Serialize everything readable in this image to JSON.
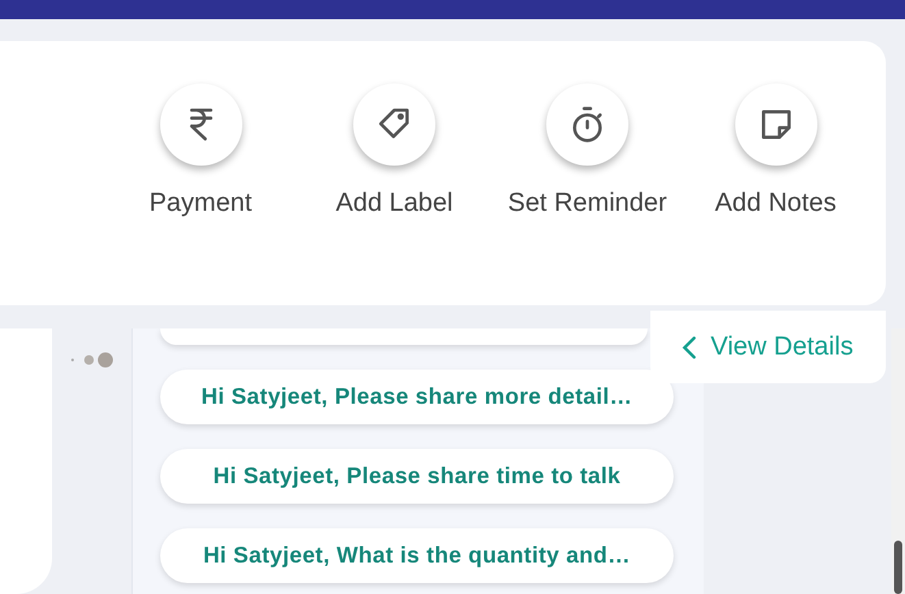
{
  "actions": [
    {
      "kind": "rupee",
      "label": "Payment"
    },
    {
      "kind": "tag",
      "label": "Add Label"
    },
    {
      "kind": "timer",
      "label": "Set Reminder"
    },
    {
      "kind": "note",
      "label": "Add Notes"
    }
  ],
  "suggestions": [
    "Hi Satyjeet, Please share more detail…",
    "Hi Satyjeet, Please share time to talk",
    "Hi Satyjeet, What is the quantity and…"
  ],
  "view_details": {
    "label": "View Details"
  }
}
